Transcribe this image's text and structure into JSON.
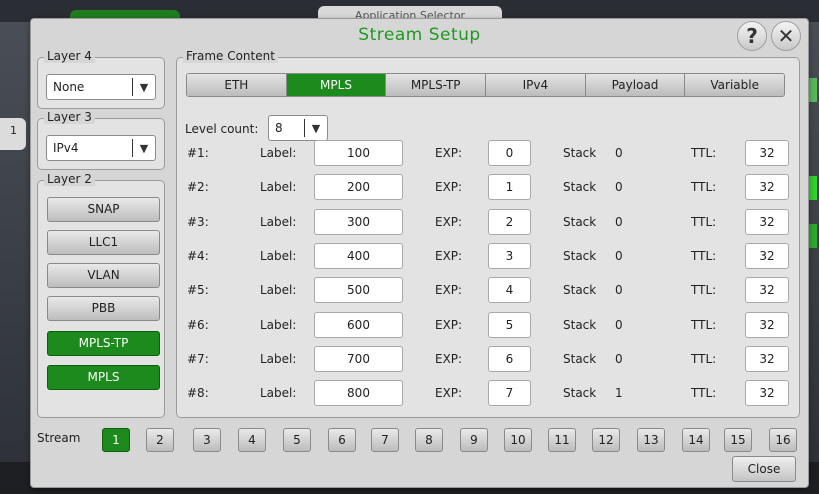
{
  "background": {
    "app_selector": "Application Selector",
    "side_number": "1"
  },
  "dialog": {
    "title": "Stream Setup",
    "help": "?",
    "close_x": "✕"
  },
  "layer4": {
    "legend": "Layer 4",
    "value": "None"
  },
  "layer3": {
    "legend": "Layer 3",
    "value": "IPv4"
  },
  "layer2": {
    "legend": "Layer 2",
    "buttons": [
      {
        "label": "SNAP",
        "active": false
      },
      {
        "label": "LLC1",
        "active": false
      },
      {
        "label": "VLAN",
        "active": false
      },
      {
        "label": "PBB",
        "active": false
      },
      {
        "label": "MPLS-TP",
        "active": true
      },
      {
        "label": "MPLS",
        "active": true
      }
    ]
  },
  "frame": {
    "legend": "Frame Content",
    "tabs": [
      "ETH",
      "MPLS",
      "MPLS-TP",
      "IPv4",
      "Payload",
      "Variable"
    ],
    "active_tab": "MPLS",
    "level_count_label": "Level count:",
    "level_count_value": "8",
    "col_label": "Label:",
    "col_exp": "EXP:",
    "col_stack": "Stack",
    "col_ttl": "TTL:",
    "rows": [
      {
        "num": "#1:",
        "label": "100",
        "exp": "0",
        "stack": "0",
        "ttl": "32"
      },
      {
        "num": "#2:",
        "label": "200",
        "exp": "1",
        "stack": "0",
        "ttl": "32"
      },
      {
        "num": "#3:",
        "label": "300",
        "exp": "2",
        "stack": "0",
        "ttl": "32"
      },
      {
        "num": "#4:",
        "label": "400",
        "exp": "3",
        "stack": "0",
        "ttl": "32"
      },
      {
        "num": "#5:",
        "label": "500",
        "exp": "4",
        "stack": "0",
        "ttl": "32"
      },
      {
        "num": "#6:",
        "label": "600",
        "exp": "5",
        "stack": "0",
        "ttl": "32"
      },
      {
        "num": "#7:",
        "label": "700",
        "exp": "6",
        "stack": "0",
        "ttl": "32"
      },
      {
        "num": "#8:",
        "label": "800",
        "exp": "7",
        "stack": "1",
        "ttl": "32"
      }
    ]
  },
  "stream": {
    "label": "Stream",
    "buttons": [
      "1",
      "2",
      "3",
      "4",
      "5",
      "6",
      "7",
      "8",
      "9",
      "10",
      "11",
      "12",
      "13",
      "14",
      "15",
      "16"
    ],
    "active": "1"
  },
  "close_label": "Close",
  "colors": {
    "accent_green": "#1c8a1c",
    "title_green": "#1e9a1e"
  }
}
